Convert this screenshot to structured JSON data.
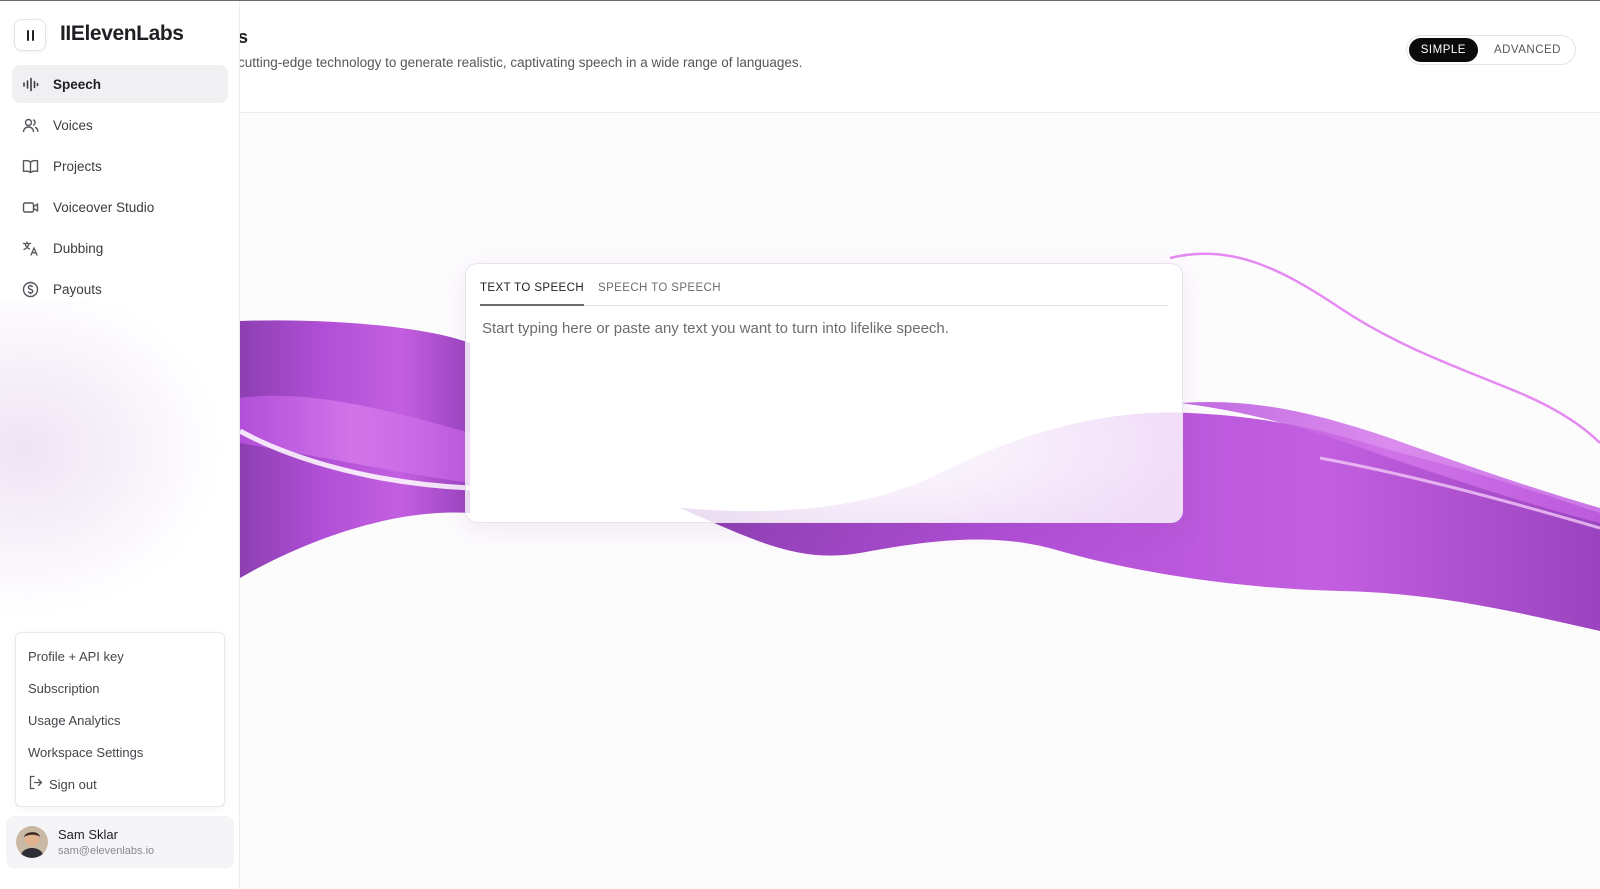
{
  "brand": {
    "name": "IIElevenLabs"
  },
  "header": {
    "title_fragment": "s",
    "subtitle": "cutting-edge technology to generate realistic, captivating speech in a wide range of languages."
  },
  "mode_toggle": {
    "simple": "SIMPLE",
    "advanced": "ADVANCED",
    "selected": "SIMPLE"
  },
  "sidebar": {
    "items": [
      {
        "label": "Speech",
        "icon": "waveform-icon",
        "active": true
      },
      {
        "label": "Voices",
        "icon": "users-icon",
        "active": false
      },
      {
        "label": "Projects",
        "icon": "book-icon",
        "active": false
      },
      {
        "label": "Voiceover Studio",
        "icon": "video-camera-icon",
        "active": false
      },
      {
        "label": "Dubbing",
        "icon": "translate-icon",
        "active": false
      },
      {
        "label": "Payouts",
        "icon": "dollar-circle-icon",
        "active": false
      }
    ]
  },
  "account_menu": {
    "items": [
      "Profile + API key",
      "Subscription",
      "Usage Analytics",
      "Workspace Settings"
    ],
    "sign_out": "Sign out"
  },
  "user": {
    "name": "Sam Sklar",
    "email": "sam@elevenlabs.io"
  },
  "tts": {
    "tabs": [
      "TEXT TO SPEECH",
      "SPEECH TO SPEECH"
    ],
    "active_tab": "TEXT TO SPEECH",
    "placeholder": "Start typing here or paste any text you want to turn into lifelike speech.",
    "value": ""
  },
  "colors": {
    "accent_purple": "#b24fd8",
    "active_toggle": "#0b0b0c"
  }
}
